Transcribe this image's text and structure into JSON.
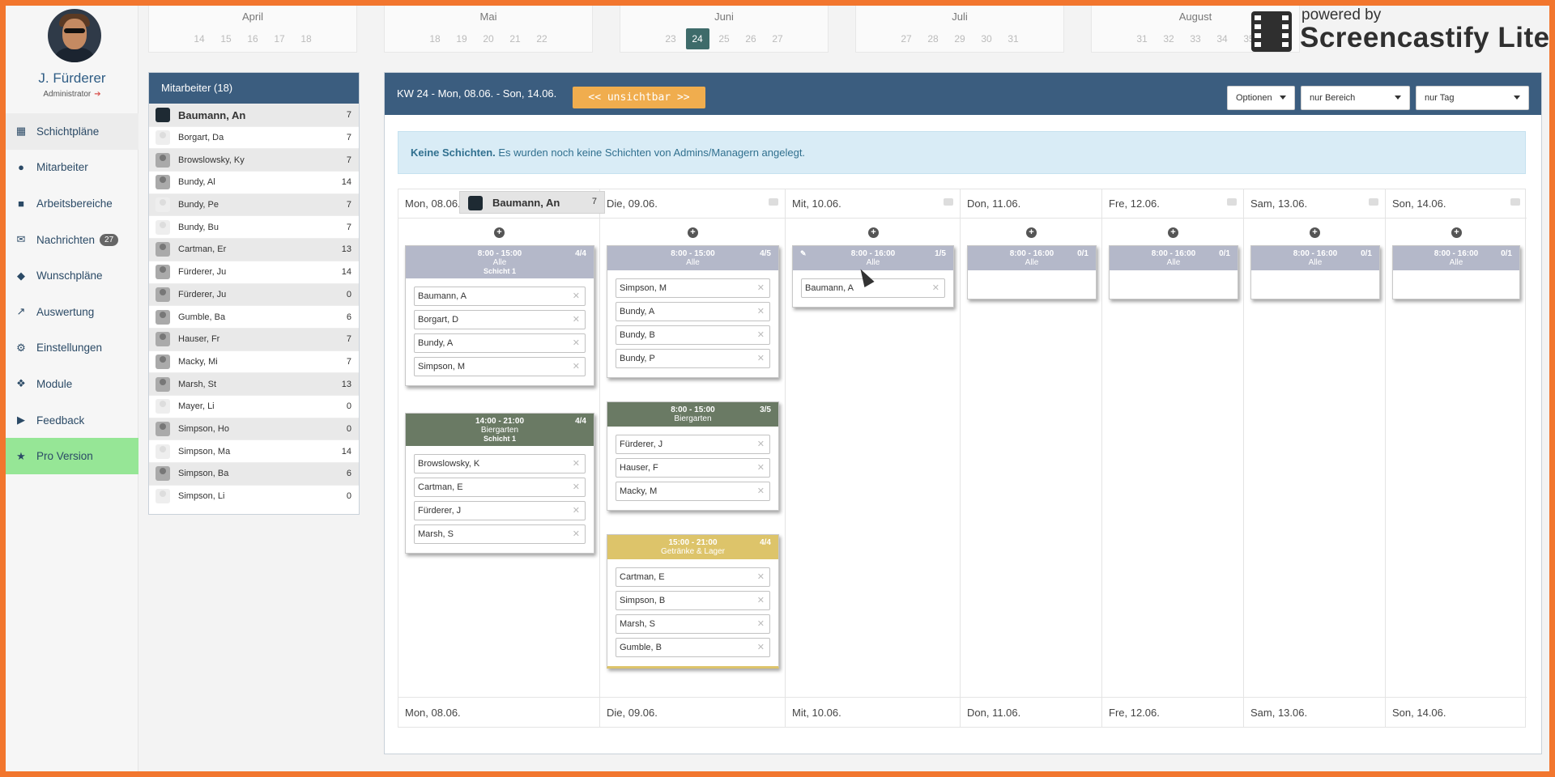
{
  "user": {
    "name": "J. Fürderer",
    "role": "Administrator"
  },
  "nav": [
    {
      "label": "Schichtpläne",
      "icon": "calendar-icon"
    },
    {
      "label": "Mitarbeiter",
      "icon": "users-icon"
    },
    {
      "label": "Arbeitsbereiche",
      "icon": "briefcase-icon"
    },
    {
      "label": "Nachrichten",
      "icon": "envelope-icon",
      "badge": "27"
    },
    {
      "label": "Wunschpläne",
      "icon": "tags-icon"
    },
    {
      "label": "Auswertung",
      "icon": "chart-icon"
    },
    {
      "label": "Einstellungen",
      "icon": "gear-icon"
    },
    {
      "label": "Module",
      "icon": "modules-icon"
    },
    {
      "label": "Feedback",
      "icon": "megaphone-icon"
    },
    {
      "label": "Pro Version",
      "icon": "star-icon"
    }
  ],
  "months": [
    {
      "name": "April",
      "weeks": [
        "14",
        "15",
        "16",
        "17",
        "18"
      ]
    },
    {
      "name": "Mai",
      "weeks": [
        "18",
        "19",
        "20",
        "21",
        "22"
      ]
    },
    {
      "name": "Juni",
      "weeks": [
        "23",
        "24",
        "25",
        "26",
        "27"
      ],
      "selected": "24"
    },
    {
      "name": "Juli",
      "weeks": [
        "27",
        "28",
        "29",
        "30",
        "31"
      ]
    },
    {
      "name": "August",
      "weeks": [
        "31",
        "32",
        "33",
        "34",
        "35"
      ]
    }
  ],
  "branding": {
    "powered_by": "powered by",
    "product": "Screencastify Lite"
  },
  "employees": {
    "title": "Mitarbeiter (18)",
    "rows": [
      {
        "name": "Baumann, An",
        "count": "7"
      },
      {
        "name": "Borgart, Da",
        "count": "7"
      },
      {
        "name": "Browslowsky, Ky",
        "count": "7"
      },
      {
        "name": "Bundy, Al",
        "count": "14"
      },
      {
        "name": "Bundy, Pe",
        "count": "7"
      },
      {
        "name": "Bundy, Bu",
        "count": "7"
      },
      {
        "name": "Cartman, Er",
        "count": "13"
      },
      {
        "name": "Fürderer, Ju",
        "count": "14"
      },
      {
        "name": "Fürderer, Ju",
        "count": "0"
      },
      {
        "name": "Gumble, Ba",
        "count": "6"
      },
      {
        "name": "Hauser, Fr",
        "count": "7"
      },
      {
        "name": "Macky, Mi",
        "count": "7"
      },
      {
        "name": "Marsh, St",
        "count": "13"
      },
      {
        "name": "Mayer, Li",
        "count": "0"
      },
      {
        "name": "Simpson, Ho",
        "count": "0"
      },
      {
        "name": "Simpson, Ma",
        "count": "14"
      },
      {
        "name": "Simpson, Ba",
        "count": "6"
      },
      {
        "name": "Simpson, Li",
        "count": "0"
      }
    ]
  },
  "header": {
    "week_label": "KW 24 - Mon, 08.06. - Son, 14.06.",
    "hidden_button": "<< unsichtbar >>",
    "options": "Optionen",
    "area_select": "nur Bereich",
    "day_select": "nur Tag"
  },
  "alert": {
    "bold": "Keine Schichten.",
    "text": " Es wurden noch keine Schichten von Admins/Managern angelegt."
  },
  "drag": {
    "name": "Baumann, An",
    "count": "7"
  },
  "days": [
    {
      "label": "Mon, 08.06."
    },
    {
      "label": "Die, 09.06."
    },
    {
      "label": "Mit, 10.06."
    },
    {
      "label": "Don, 11.06."
    },
    {
      "label": "Fre, 12.06."
    },
    {
      "label": "Sam, 13.06."
    },
    {
      "label": "Son, 14.06."
    }
  ],
  "shifts": {
    "mon_1": {
      "time": "8:00 - 15:00",
      "count": "4/4",
      "area": "Alle",
      "name": "Schicht 1",
      "people": [
        "Baumann, A",
        "Borgart, D",
        "Bundy, A",
        "Simpson, M"
      ]
    },
    "mon_2": {
      "time": "14:00 - 21:00",
      "count": "4/4",
      "area": "Biergarten",
      "name": "Schicht 1",
      "people": [
        "Browslowsky, K",
        "Cartman, E",
        "Fürderer, J",
        "Marsh, S"
      ]
    },
    "die_1": {
      "time": "8:00 - 15:00",
      "count": "4/5",
      "area": "Alle",
      "people": [
        "Simpson, M",
        "Bundy, A",
        "Bundy, B",
        "Bundy, P"
      ]
    },
    "die_2": {
      "time": "8:00 - 15:00",
      "count": "3/5",
      "area": "Biergarten",
      "people": [
        "Fürderer, J",
        "Hauser, F",
        "Macky, M"
      ]
    },
    "die_3": {
      "time": "15:00 - 21:00",
      "count": "4/4",
      "area": "Getränke & Lager",
      "people": [
        "Cartman, E",
        "Simpson, B",
        "Marsh, S",
        "Gumble, B"
      ]
    },
    "mit_1": {
      "time": "8:00 - 16:00",
      "count": "1/5",
      "area": "Alle",
      "people": [
        "Baumann, A"
      ]
    },
    "don_1": {
      "time": "8:00 - 16:00",
      "count": "0/1",
      "area": "Alle"
    },
    "fre_1": {
      "time": "8:00 - 16:00",
      "count": "0/1",
      "area": "Alle"
    },
    "sam_1": {
      "time": "8:00 - 16:00",
      "count": "0/1",
      "area": "Alle"
    },
    "son_1": {
      "time": "8:00 - 16:00",
      "count": "0/1",
      "area": "Alle"
    }
  }
}
